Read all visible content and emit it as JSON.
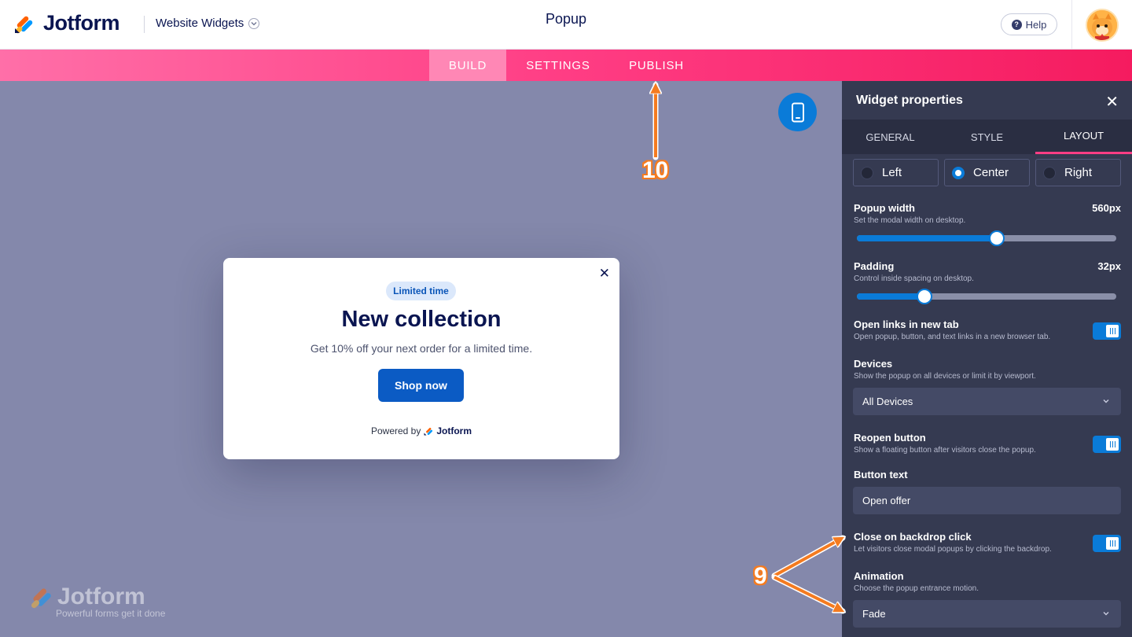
{
  "header": {
    "logo_text": "Jotform",
    "widget_type": "Website Widgets",
    "title": "Popup",
    "help_label": "Help"
  },
  "nav": {
    "tabs": [
      "BUILD",
      "SETTINGS",
      "PUBLISH"
    ],
    "active": "BUILD"
  },
  "popup": {
    "badge": "Limited time",
    "title": "New collection",
    "subtitle": "Get 10% off your next order for a limited time.",
    "button": "Shop now",
    "powered_prefix": "Powered by",
    "powered_brand": "Jotform"
  },
  "watermark": {
    "name": "Jotform",
    "tagline": "Powerful forms get it done"
  },
  "panel": {
    "title": "Widget properties",
    "tabs": [
      "GENERAL",
      "STYLE",
      "LAYOUT"
    ],
    "active_tab": "LAYOUT",
    "alignment": {
      "options": [
        "Left",
        "Center",
        "Right"
      ],
      "selected": "Center"
    },
    "popup_width": {
      "label": "Popup width",
      "desc": "Set the modal width on desktop.",
      "value": "560px",
      "fraction": 0.54
    },
    "padding": {
      "label": "Padding",
      "desc": "Control inside spacing on desktop.",
      "value": "32px",
      "fraction": 0.26
    },
    "open_links": {
      "label": "Open links in new tab",
      "desc": "Open popup, button, and text links in a new browser tab.",
      "on": true
    },
    "devices": {
      "label": "Devices",
      "desc": "Show the popup on all devices or limit it by viewport.",
      "value": "All Devices"
    },
    "reopen": {
      "label": "Reopen button",
      "desc": "Show a floating button after visitors close the popup.",
      "on": true
    },
    "button_text": {
      "label": "Button text",
      "value": "Open offer"
    },
    "close_backdrop": {
      "label": "Close on backdrop click",
      "desc": "Let visitors close modal popups by clicking the backdrop.",
      "on": true
    },
    "animation": {
      "label": "Animation",
      "desc": "Choose the popup entrance motion.",
      "value": "Fade"
    }
  },
  "annotations": {
    "a9": "9",
    "a10": "10",
    "color": "#f47b20"
  },
  "colors": {
    "brand_blue": "#0a1551",
    "accent_pink": "#ff3d84",
    "primary_blue": "#0a7bd8",
    "panel_bg": "#353a51",
    "canvas_bg": "#8488ab"
  }
}
